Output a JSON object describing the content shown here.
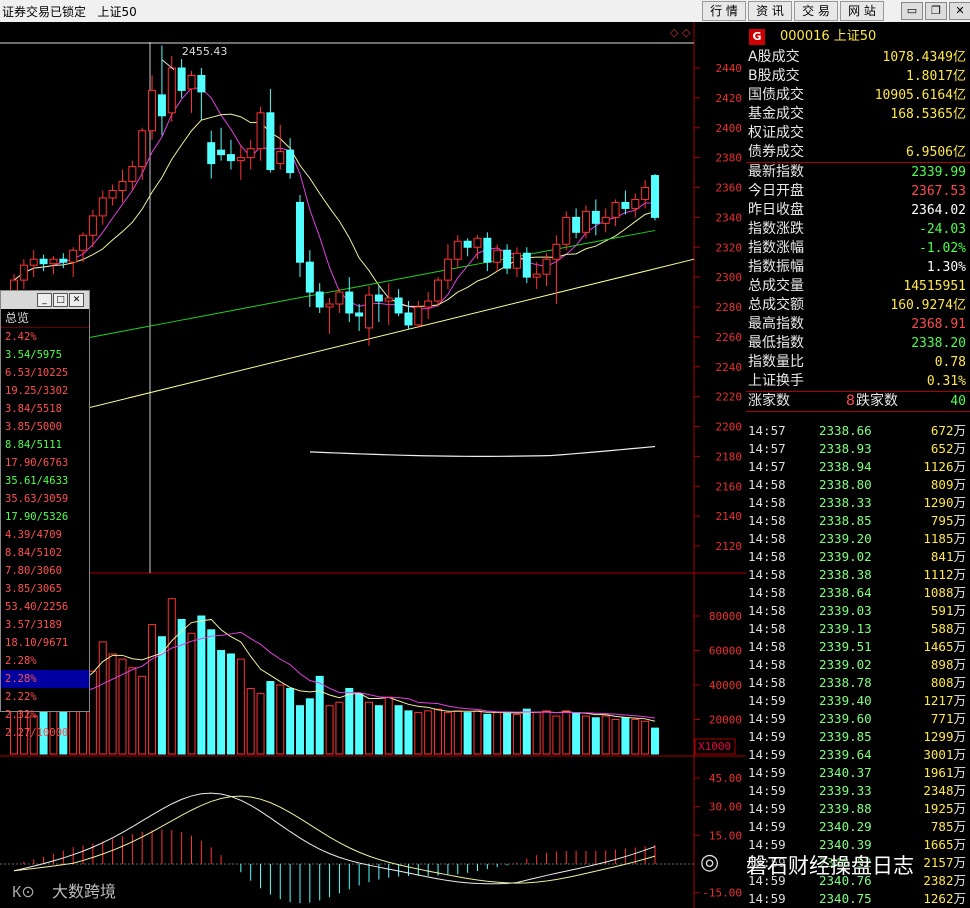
{
  "window": {
    "title": "证券交易已锁定",
    "index_name": "上证50",
    "menu": [
      "行 情",
      "资 讯",
      "交 易",
      "网 站"
    ],
    "wbtns": [
      "▭",
      "❐",
      "✕"
    ]
  },
  "colors": {
    "up": "#ff3232",
    "down": "#54ffff",
    "ma1": "#e040e0",
    "ma2": "#f0f0a0",
    "ma3": "#20d020",
    "trend": "#ffff99"
  },
  "chart_data": {
    "type": "candlestick",
    "peak_label": "2455.43",
    "price_axis": {
      "ylim": [
        2100,
        2460
      ],
      "ticks": [
        "2440",
        "2420",
        "2400",
        "2380",
        "2360",
        "2340",
        "2320",
        "2300",
        "2280",
        "2260",
        "2240",
        "2220",
        "2200",
        "2180",
        "2160",
        "2140",
        "2120"
      ]
    },
    "candles": [
      [
        2290,
        2302,
        2284,
        2298
      ],
      [
        2298,
        2312,
        2292,
        2308
      ],
      [
        2308,
        2318,
        2300,
        2312
      ],
      [
        2312,
        2315,
        2304,
        2309
      ],
      [
        2309,
        2314,
        2302,
        2312
      ],
      [
        2312,
        2316,
        2306,
        2310
      ],
      [
        2310,
        2320,
        2300,
        2318
      ],
      [
        2318,
        2330,
        2310,
        2328
      ],
      [
        2328,
        2345,
        2320,
        2341
      ],
      [
        2341,
        2358,
        2335,
        2353
      ],
      [
        2353,
        2362,
        2348,
        2358
      ],
      [
        2358,
        2372,
        2350,
        2364
      ],
      [
        2364,
        2378,
        2358,
        2374
      ],
      [
        2374,
        2400,
        2365,
        2398
      ],
      [
        2398,
        2435,
        2392,
        2425
      ],
      [
        2422,
        2455,
        2395,
        2408
      ],
      [
        2410,
        2448,
        2404,
        2440
      ],
      [
        2440,
        2446,
        2420,
        2425
      ],
      [
        2426,
        2438,
        2410,
        2435
      ],
      [
        2435,
        2440,
        2405,
        2424
      ],
      [
        2390,
        2398,
        2366,
        2376
      ],
      [
        2385,
        2400,
        2378,
        2382
      ],
      [
        2382,
        2392,
        2372,
        2378
      ],
      [
        2378,
        2388,
        2365,
        2380
      ],
      [
        2380,
        2392,
        2372,
        2386
      ],
      [
        2386,
        2414,
        2378,
        2410
      ],
      [
        2410,
        2426,
        2370,
        2372
      ],
      [
        2376,
        2402,
        2372,
        2384
      ],
      [
        2385,
        2393,
        2366,
        2370
      ],
      [
        2350,
        2355,
        2300,
        2310
      ],
      [
        2310,
        2318,
        2280,
        2290
      ],
      [
        2290,
        2296,
        2276,
        2280
      ],
      [
        2280,
        2286,
        2262,
        2282
      ],
      [
        2282,
        2292,
        2276,
        2290
      ],
      [
        2290,
        2300,
        2270,
        2276
      ],
      [
        2276,
        2282,
        2264,
        2274
      ],
      [
        2266,
        2294,
        2254,
        2288
      ],
      [
        2288,
        2294,
        2270,
        2284
      ],
      [
        2284,
        2296,
        2268,
        2286
      ],
      [
        2286,
        2292,
        2274,
        2276
      ],
      [
        2276,
        2284,
        2265,
        2268
      ],
      [
        2268,
        2284,
        2266,
        2280
      ],
      [
        2280,
        2290,
        2272,
        2284
      ],
      [
        2284,
        2300,
        2280,
        2298
      ],
      [
        2298,
        2322,
        2292,
        2312
      ],
      [
        2312,
        2328,
        2306,
        2324
      ],
      [
        2324,
        2326,
        2314,
        2320
      ],
      [
        2320,
        2328,
        2312,
        2326
      ],
      [
        2326,
        2330,
        2304,
        2310
      ],
      [
        2310,
        2322,
        2304,
        2318
      ],
      [
        2318,
        2322,
        2302,
        2306
      ],
      [
        2306,
        2320,
        2300,
        2316
      ],
      [
        2316,
        2320,
        2296,
        2300
      ],
      [
        2300,
        2310,
        2292,
        2302
      ],
      [
        2302,
        2316,
        2294,
        2312
      ],
      [
        2312,
        2328,
        2282,
        2322
      ],
      [
        2322,
        2344,
        2318,
        2340
      ],
      [
        2340,
        2346,
        2326,
        2330
      ],
      [
        2330,
        2348,
        2326,
        2344
      ],
      [
        2344,
        2352,
        2328,
        2336
      ],
      [
        2336,
        2346,
        2330,
        2340
      ],
      [
        2340,
        2352,
        2334,
        2350
      ],
      [
        2350,
        2358,
        2342,
        2346
      ],
      [
        2346,
        2356,
        2340,
        2352
      ],
      [
        2352,
        2365,
        2346,
        2360
      ],
      [
        2368,
        2369,
        2338,
        2340
      ]
    ],
    "volume_axis": {
      "ylim": [
        0,
        110000
      ],
      "ticks": [
        "80000",
        "60000",
        "40000",
        "20000"
      ],
      "unit": "X1000"
    },
    "volumes": [
      30000,
      28000,
      22000,
      25000,
      33000,
      40000,
      55000,
      60000,
      48000,
      65000,
      58000,
      55000,
      50000,
      45000,
      75000,
      68000,
      90000,
      78000,
      70000,
      80000,
      72000,
      60000,
      58000,
      55000,
      38000,
      35000,
      42000,
      40000,
      38000,
      28000,
      32000,
      45000,
      28000,
      30000,
      38000,
      35000,
      30000,
      28000,
      33000,
      28000,
      25000,
      24000,
      25000,
      26000,
      24000,
      25000,
      24000,
      25000,
      23000,
      24000,
      24000,
      23000,
      26000,
      24000,
      25000,
      22000,
      25000,
      24000,
      22000,
      21000,
      22000,
      20000,
      21000,
      20000,
      19000,
      15000
    ],
    "macd_axis": {
      "ylim": [
        -18,
        52
      ],
      "ticks": [
        "45.00",
        "30.00",
        "15.00",
        "-15.00"
      ]
    }
  },
  "right_panel": {
    "code_badge": "G",
    "code": "000016 上证50",
    "stats": [
      {
        "label": "A股成交",
        "value": "1078.4349亿",
        "color": "#ffe84a"
      },
      {
        "label": "B股成交",
        "value": "1.8017亿",
        "color": "#ffe84a"
      },
      {
        "label": "国债成交",
        "value": "10905.6164亿",
        "color": "#ffe84a"
      },
      {
        "label": "基金成交",
        "value": "168.5365亿",
        "color": "#ffe84a"
      },
      {
        "label": "权证成交",
        "value": "",
        "color": "#ffe84a"
      },
      {
        "label": "债券成交",
        "value": "6.9506亿",
        "color": "#ffe84a"
      }
    ],
    "quote": [
      {
        "label": "最新指数",
        "value": "2339.99",
        "color": "#4cff4c"
      },
      {
        "label": "今日开盘",
        "value": "2367.53",
        "color": "#ff4c4c"
      },
      {
        "label": "昨日收盘",
        "value": "2364.02",
        "color": "#ffffff"
      },
      {
        "label": "指数涨跌",
        "value": "-24.03",
        "color": "#4cff4c"
      },
      {
        "label": "指数涨幅",
        "value": "-1.02%",
        "color": "#4cff4c"
      },
      {
        "label": "指数振幅",
        "value": "1.30%",
        "color": "#ffffff"
      },
      {
        "label": "总成交量",
        "value": "14515951",
        "color": "#ffe84a"
      },
      {
        "label": "总成交额",
        "value": "160.9274亿",
        "color": "#ffe84a"
      },
      {
        "label": "最高指数",
        "value": "2368.91",
        "color": "#ff4c4c"
      },
      {
        "label": "最低指数",
        "value": "2338.20",
        "color": "#4cff4c"
      },
      {
        "label": "指数量比",
        "value": "0.78",
        "color": "#ffe84a"
      },
      {
        "label": "上证换手",
        "value": "0.31%",
        "color": "#ffe84a"
      }
    ],
    "breadth": {
      "up_label": "涨家数",
      "up": "8",
      "down_label": "跌家数",
      "down": "40"
    },
    "ticks": [
      [
        "14:57",
        "2338.66",
        "672"
      ],
      [
        "14:57",
        "2338.93",
        "652"
      ],
      [
        "14:57",
        "2338.94",
        "1126"
      ],
      [
        "14:58",
        "2338.80",
        "809"
      ],
      [
        "14:58",
        "2338.33",
        "1290"
      ],
      [
        "14:58",
        "2338.85",
        "795"
      ],
      [
        "14:58",
        "2339.20",
        "1185"
      ],
      [
        "14:58",
        "2339.02",
        "841"
      ],
      [
        "14:58",
        "2338.38",
        "1112"
      ],
      [
        "14:58",
        "2338.64",
        "1088"
      ],
      [
        "14:58",
        "2339.03",
        "591"
      ],
      [
        "14:58",
        "2339.13",
        "588"
      ],
      [
        "14:58",
        "2339.51",
        "1465"
      ],
      [
        "14:58",
        "2339.02",
        "898"
      ],
      [
        "14:58",
        "2338.78",
        "808"
      ],
      [
        "14:59",
        "2339.40",
        "1217"
      ],
      [
        "14:59",
        "2339.60",
        "771"
      ],
      [
        "14:59",
        "2339.85",
        "1299"
      ],
      [
        "14:59",
        "2339.64",
        "3001"
      ],
      [
        "14:59",
        "2340.37",
        "1961"
      ],
      [
        "14:59",
        "2339.33",
        "2348"
      ],
      [
        "14:59",
        "2339.88",
        "1925"
      ],
      [
        "14:59",
        "2340.29",
        "785"
      ],
      [
        "14:59",
        "2340.39",
        "1665"
      ],
      [
        "14:59",
        "2340.52",
        "2157"
      ],
      [
        "14:59",
        "2340.76",
        "2382"
      ],
      [
        "14:59",
        "2340.75",
        "1262"
      ]
    ],
    "vol_unit": "万"
  },
  "popup": {
    "title": "总览",
    "items": [
      {
        "text": "2.42%",
        "color": "#ff5050"
      },
      {
        "text": "3.54/5975",
        "color": "#50ff50"
      },
      {
        "text": "6.53/10225",
        "color": "#ff5050"
      },
      {
        "text": "19.25/3302",
        "color": "#ff5050"
      },
      {
        "text": "3.84/5518",
        "color": "#ff5050"
      },
      {
        "text": "3.85/5000",
        "color": "#ff5050"
      },
      {
        "text": "8.84/5111",
        "color": "#50ff50"
      },
      {
        "text": "17.90/6763",
        "color": "#ff5050"
      },
      {
        "text": "35.61/4633",
        "color": "#50ff50"
      },
      {
        "text": "35.63/3059",
        "color": "#ff5050"
      },
      {
        "text": "17.90/5326",
        "color": "#50ff50"
      },
      {
        "text": "4.39/4709",
        "color": "#ff5050"
      },
      {
        "text": "8.84/5102",
        "color": "#ff5050"
      },
      {
        "text": "7.80/3060",
        "color": "#ff5050"
      },
      {
        "text": "3.85/3065",
        "color": "#ff5050"
      },
      {
        "text": "53.40/2256",
        "color": "#ff5050"
      },
      {
        "text": "3.57/3189",
        "color": "#ff5050"
      },
      {
        "text": "18.10/9671",
        "color": "#ff5050"
      },
      {
        "text": "2.28%",
        "color": "#ff5050"
      },
      {
        "text": "2.28%",
        "color": "#ff5050"
      },
      {
        "text": "2.22%",
        "color": "#ff5050"
      },
      {
        "text": "2.32%",
        "color": "#ff5050"
      },
      {
        "text": "2.27/10000",
        "color": "#ff5050"
      }
    ],
    "selected_index": 19
  },
  "watermarks": {
    "left": "大数跨境",
    "right": "磐石财经操盘日志"
  }
}
